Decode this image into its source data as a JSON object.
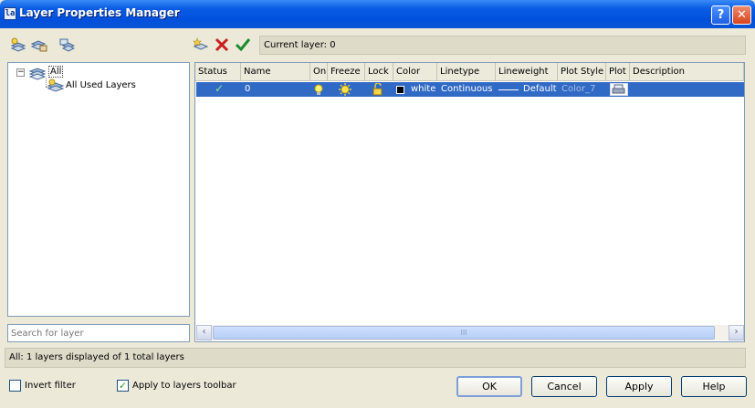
{
  "window": {
    "title": "Layer Properties Manager",
    "app_icon_label": "la",
    "help_label": "?",
    "close_label": "✕"
  },
  "toolbar": {
    "current_layer_text": "Current layer: 0",
    "icons": [
      "new-property-filter-icon",
      "new-group-filter-icon",
      "layer-states-manager-icon",
      "new-layer-icon",
      "delete-layer-icon",
      "set-current-icon"
    ]
  },
  "tree": {
    "root_label": "All",
    "child_label": "All Used Layers",
    "expand_symbol": "−"
  },
  "search": {
    "placeholder": "Search for layer"
  },
  "columns": [
    "Status",
    "Name",
    "On",
    "Freeze",
    "Lock",
    "Color",
    "Linetype",
    "Lineweight",
    "Plot Style",
    "Plot",
    "Description"
  ],
  "layers": [
    {
      "status": "✓",
      "name": "0",
      "on": "on",
      "freeze": "thawed",
      "lock": "unlocked",
      "color": "white",
      "color_hex": "#000000",
      "linetype": "Continuous",
      "lineweight": "Default",
      "plot_style": "Color_7",
      "plot": "plot",
      "description": ""
    }
  ],
  "scrollbar": {
    "left_arrow": "‹",
    "right_arrow": "›",
    "grip": "III"
  },
  "status_text": "All: 1 layers displayed of 1 total layers",
  "options": {
    "invert_filter": {
      "label": "Invert filter",
      "checked": false
    },
    "apply_toolbar": {
      "label": "Apply to layers toolbar",
      "checked": true,
      "mark": "✓"
    }
  },
  "buttons": {
    "ok": "OK",
    "cancel": "Cancel",
    "apply": "Apply",
    "help": "Help"
  },
  "colors": {
    "title_bar": "#0050dd",
    "selection": "#316ac5",
    "dialog_bg": "#ece9d8"
  }
}
